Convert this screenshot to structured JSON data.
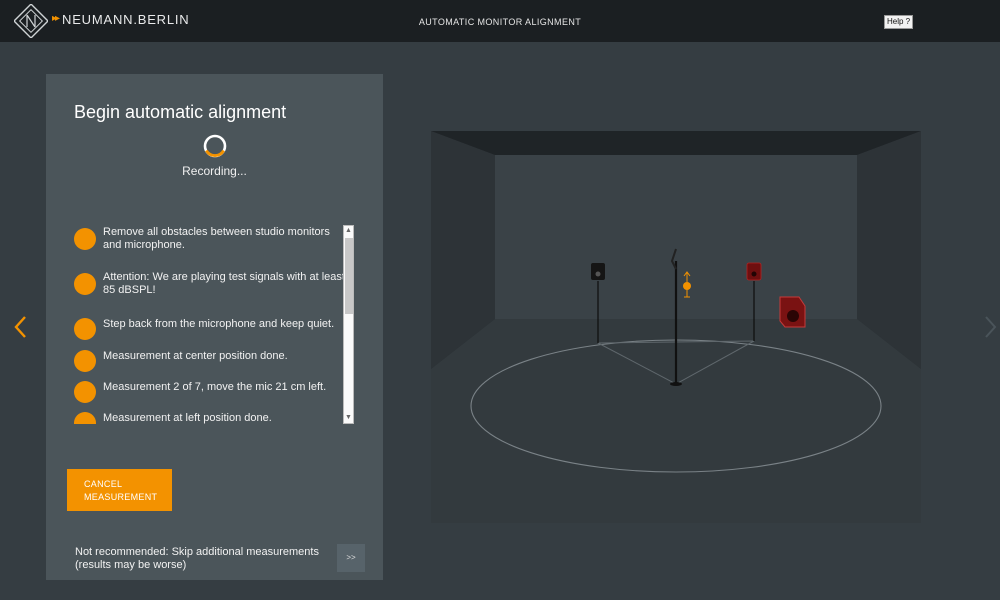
{
  "topbar": {
    "brand": "NEUMANN.BERLIN",
    "brand_arrows": "▸▸",
    "title": "AUTOMATIC MONITOR ALIGNMENT",
    "help_label": "Help ?"
  },
  "panel": {
    "title": "Begin automatic alignment",
    "status": "Recording...",
    "steps": [
      {
        "text": "Remove all obstacles between studio monitors and microphone."
      },
      {
        "text": "Attention: We are playing test signals with at least 85 dBSPL!"
      },
      {
        "text": "Step back from the microphone and keep quiet."
      },
      {
        "text": "Measurement at center position done."
      },
      {
        "text": "Measurement 2 of 7, move the mic 21 cm left."
      },
      {
        "text": "Measurement at left position done."
      }
    ],
    "cancel_label": "CANCEL\nMEASUREMENT",
    "skip_text": "Not recommended: Skip additional measurements (results may be worse)",
    "skip_button": ">>"
  },
  "icons": {
    "logo": "neumann-diamond-logo",
    "prev": "chevron-left-icon",
    "next": "chevron-right-icon",
    "spinner": "loading-spinner-icon"
  },
  "colors": {
    "accent": "#f39200",
    "topbar": "#1b1f22",
    "background": "#353d42",
    "panel": "#4b555a",
    "speaker_active": "#7a1212"
  }
}
